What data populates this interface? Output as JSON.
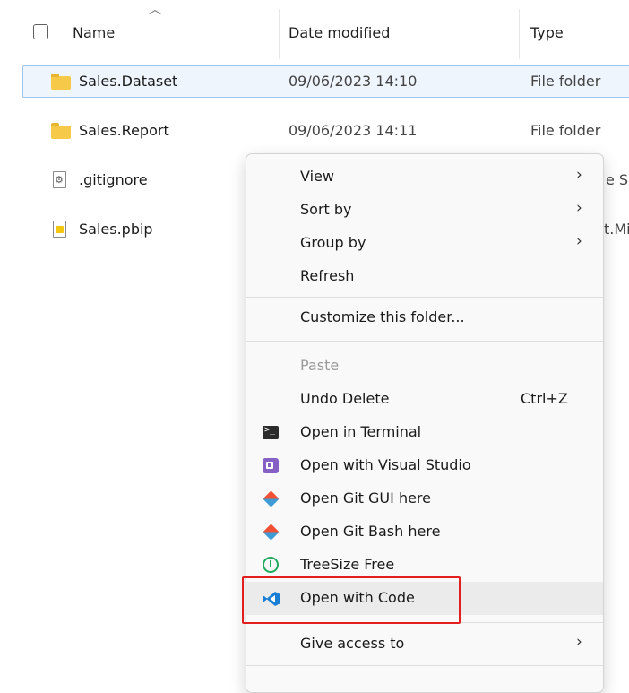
{
  "header": {
    "name": "Name",
    "date_modified": "Date modified",
    "type": "Type"
  },
  "files": [
    {
      "name": "Sales.Dataset",
      "date": "09/06/2023 14:10",
      "type": "File folder",
      "icon": "folder-icon"
    },
    {
      "name": "Sales.Report",
      "date": "09/06/2023 14:11",
      "type": "File folder",
      "icon": "folder-icon"
    },
    {
      "name": ".gitignore",
      "date": "",
      "type": "e Sc",
      "icon": "settings-file-icon"
    },
    {
      "name": "Sales.pbip",
      "date": "",
      "type": "t.Mi",
      "icon": "pbip-file-icon"
    }
  ],
  "menu": {
    "view": "View",
    "sort_by": "Sort by",
    "group_by": "Group by",
    "refresh": "Refresh",
    "customize": "Customize this folder...",
    "paste": "Paste",
    "undo_delete": "Undo Delete",
    "undo_shortcut": "Ctrl+Z",
    "open_terminal": "Open in Terminal",
    "open_vs": "Open with Visual Studio",
    "git_gui": "Open Git GUI here",
    "git_bash": "Open Git Bash here",
    "treesize": "TreeSize Free",
    "open_code": "Open with Code",
    "give_access": "Give access to",
    "chevron": "›"
  },
  "colors": {
    "highlight": "#e21f1f",
    "selection_border": "#9cc4ea",
    "folder": "#f7c948"
  }
}
